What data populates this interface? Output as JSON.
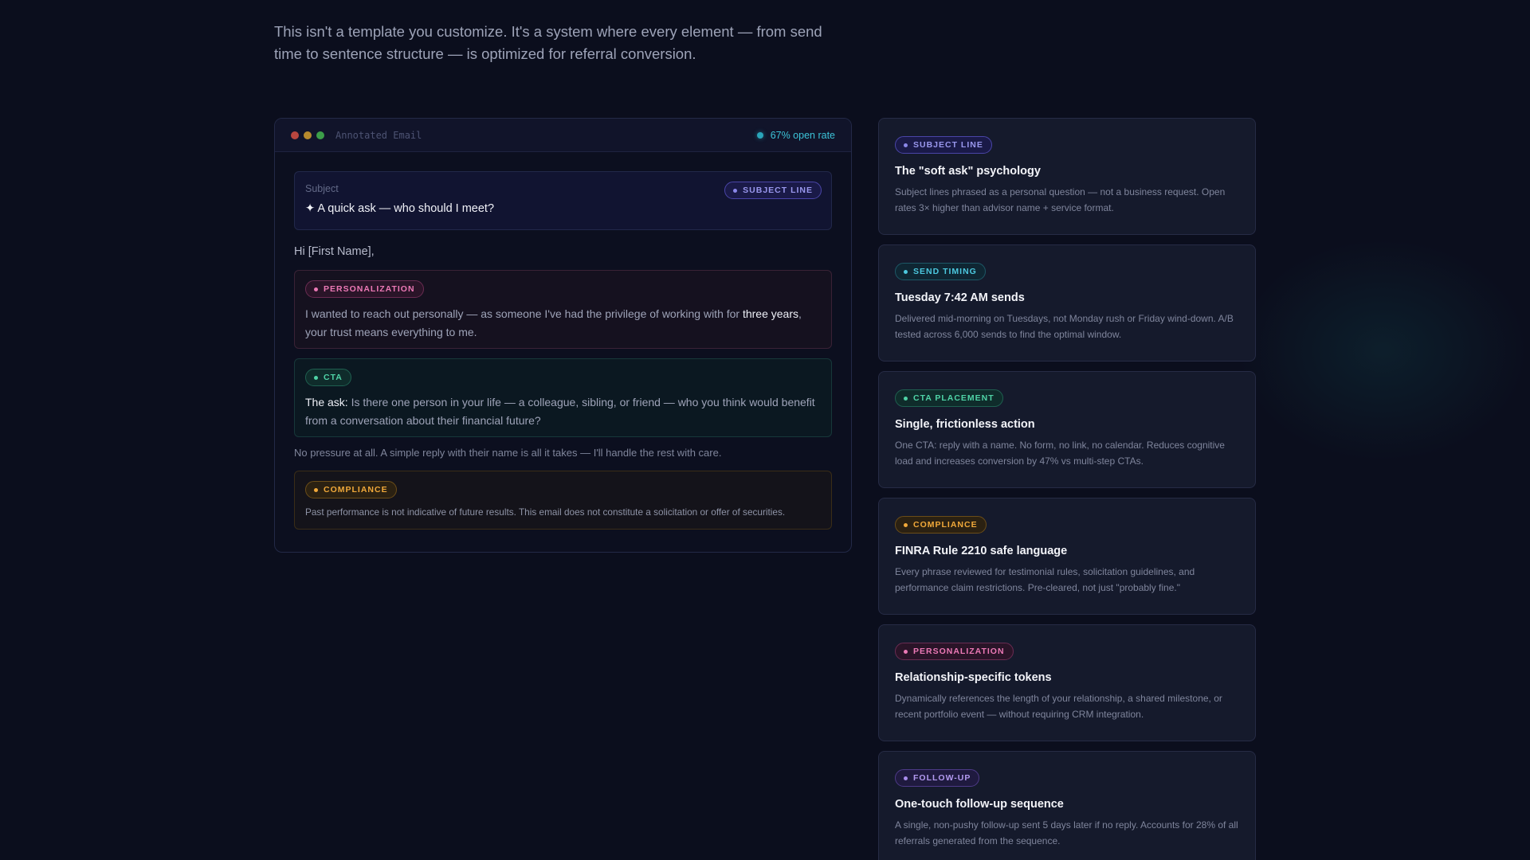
{
  "hero": {
    "subtitle": "This isn't a template you customize. It's a system where every element — from send time to sentence structure — is optimized for referral conversion."
  },
  "email_panel": {
    "title": "Annotated Email",
    "open_rate": "67% open rate",
    "subject_label": "Subject",
    "subject_tag": "SUBJECT LINE",
    "subject_text": "✦ A quick ask — who should I meet?",
    "greeting": "Hi [First Name],",
    "personalization": {
      "tag": "PERSONALIZATION",
      "text_before": "I wanted to reach out personally — as someone I've had the privilege of working with for ",
      "highlight": "three years",
      "text_after": ", your trust means everything to me."
    },
    "cta": {
      "tag": "CTA",
      "lead": "The ask:",
      "text": " Is there one person in your life — a colleague, sibling, or friend — who you think would benefit from a conversation about their financial future?"
    },
    "pressure_line": "No pressure at all. A simple reply with their name is all it takes — I'll handle the rest with care.",
    "compliance": {
      "tag": "COMPLIANCE",
      "text": "Past performance is not indicative of future results. This email does not constitute a solicitation or offer of securities."
    }
  },
  "cards": [
    {
      "tag": "SUBJECT LINE",
      "title": "The \"soft ask\" psychology",
      "desc": "Subject lines phrased as a personal question — not a business request. Open rates 3× higher than advisor name + service format."
    },
    {
      "tag": "SEND TIMING",
      "title": "Tuesday 7:42 AM sends",
      "desc": "Delivered mid-morning on Tuesdays, not Monday rush or Friday wind-down. A/B tested across 6,000 sends to find the optimal window."
    },
    {
      "tag": "CTA PLACEMENT",
      "title": "Single, frictionless action",
      "desc": "One CTA: reply with a name. No form, no link, no calendar. Reduces cognitive load and increases conversion by 47% vs multi-step CTAs."
    },
    {
      "tag": "COMPLIANCE",
      "title": "FINRA Rule 2210 safe language",
      "desc": "Every phrase reviewed for testimonial rules, solicitation guidelines, and performance claim restrictions. Pre-cleared, not just \"probably fine.\""
    },
    {
      "tag": "PERSONALIZATION",
      "title": "Relationship-specific tokens",
      "desc": "Dynamically references the length of your relationship, a shared milestone, or recent portfolio event — without requiring CRM integration."
    },
    {
      "tag": "FOLLOW-UP",
      "title": "One-touch follow-up sequence",
      "desc": "A single, non-pushy follow-up sent 5 days later if no reply. Accounts for 28% of all referrals generated from the sequence."
    }
  ],
  "colors": {
    "background": "#0b0e1d",
    "subject_accent": "#9a98ee",
    "personalization_accent": "#ec79b6",
    "cta_accent": "#4fd3a6",
    "compliance_accent": "#f1a93a",
    "timing_accent": "#4cc8df",
    "followup_accent": "#b39af0"
  }
}
